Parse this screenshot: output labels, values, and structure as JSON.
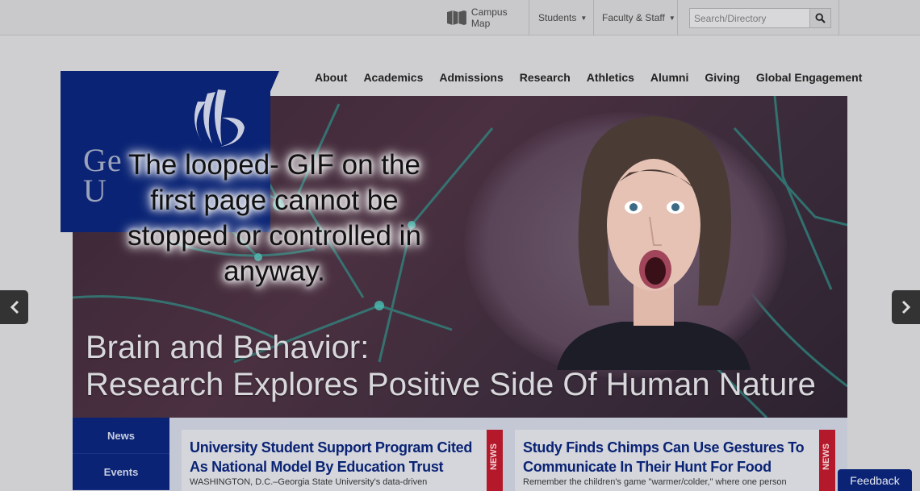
{
  "utility": {
    "campus_map": "Campus Map",
    "students": "Students",
    "faculty_staff": "Faculty & Staff",
    "search_placeholder": "Search/Directory"
  },
  "logo": {
    "text_line1": "Ge",
    "text_line2": "U"
  },
  "nav": {
    "items": [
      "About",
      "Academics",
      "Admissions",
      "Research",
      "Athletics",
      "Alumni",
      "Giving",
      "Global Engagement"
    ]
  },
  "hero": {
    "headline_line1": "Brain and Behavior:",
    "headline_line2": "Research Explores Positive Side Of Human Nature"
  },
  "annotation": {
    "line1": "The looped- GIF on the",
    "line2": "first page  cannot be",
    "line3": "stopped or controlled in",
    "line4": "anyway."
  },
  "tabs": [
    "News",
    "Events"
  ],
  "cards": [
    {
      "title_line1": "University Student Support Program Cited",
      "title_line2": "As National Model By Education Trust",
      "excerpt": "WASHINGTON, D.C.–Georgia State University's data-driven",
      "ribbon": "NEWS"
    },
    {
      "title_line1": "Study Finds Chimps Can Use Gestures To",
      "title_line2": "Communicate In Their Hunt For Food",
      "excerpt": "Remember the children's game \"warmer/colder,\" where one person",
      "ribbon": "NEWS"
    }
  ],
  "feedback": "Feedback",
  "colors": {
    "brand_blue": "#0a2374",
    "news_red": "#b3192a"
  }
}
